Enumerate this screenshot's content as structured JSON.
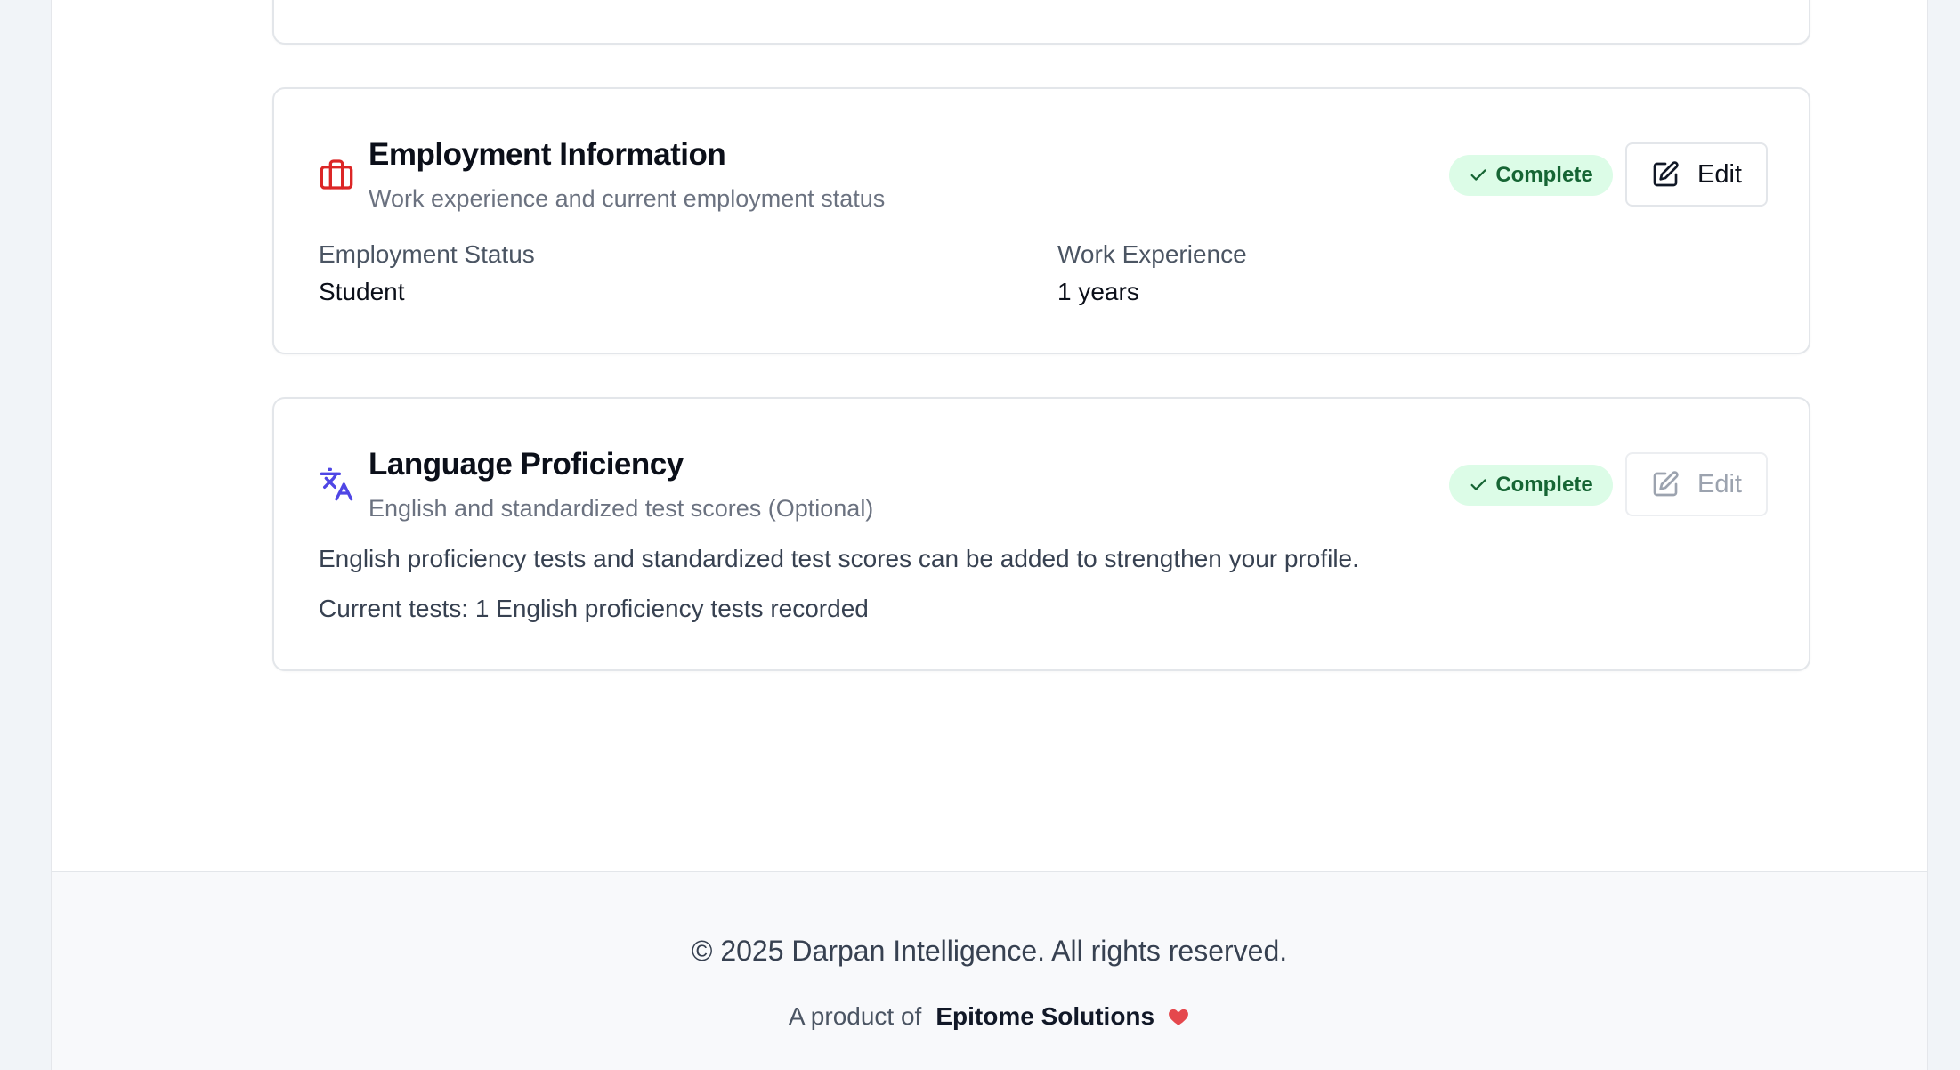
{
  "employment": {
    "title": "Employment Information",
    "subtitle": "Work experience and current employment status",
    "status": "Complete",
    "edit_label": "Edit",
    "icon": "briefcase-icon",
    "fields": [
      {
        "label": "Employment Status",
        "value": "Student"
      },
      {
        "label": "Work Experience",
        "value": "1 years"
      }
    ]
  },
  "language": {
    "title": "Language Proficiency",
    "subtitle": "English and standardized test scores (Optional)",
    "status": "Complete",
    "edit_label": "Edit",
    "icon": "translate-icon",
    "description": "English proficiency tests and standardized test scores can be added to strengthen your profile.",
    "current_tests": "Current tests: 1 English proficiency tests recorded"
  },
  "footer": {
    "copyright": "© 2025 Darpan Intelligence. All rights reserved.",
    "product_prefix": "A product of",
    "product_name": "Epitome Solutions",
    "heart_icon": "heart-icon"
  },
  "colors": {
    "briefcase_icon": "#dc2626",
    "translate_icon": "#4f46e5",
    "badge_bg": "#dcfce7",
    "badge_text": "#166534",
    "heart": "#e5484d"
  }
}
